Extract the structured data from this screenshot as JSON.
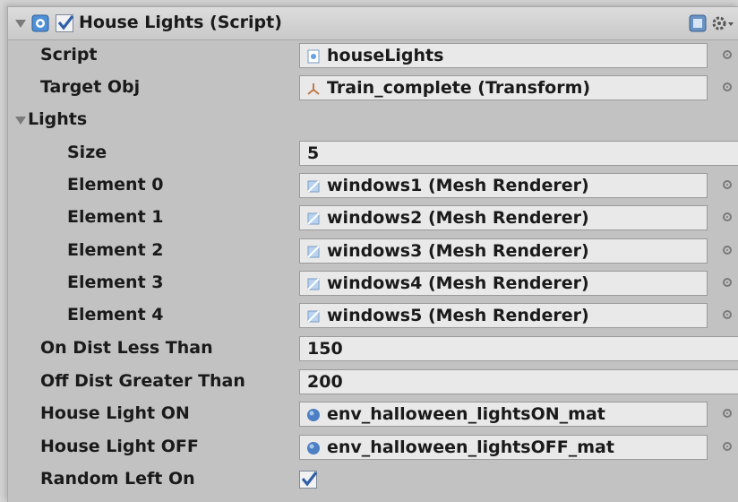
{
  "component": {
    "title": "House Lights (Script)",
    "enabled": true,
    "icons": [
      "script-icon",
      "help-book-icon",
      "gear-menu-icon"
    ]
  },
  "script": {
    "label": "Script",
    "value": "houseLights"
  },
  "target_obj": {
    "label": "Target Obj",
    "value": "Train_complete (Transform)"
  },
  "lights": {
    "label": "Lights",
    "expanded": true,
    "size_label": "Size",
    "size_value": "5",
    "elements": [
      {
        "label": "Element 0",
        "value": "windows1 (Mesh Renderer)"
      },
      {
        "label": "Element 1",
        "value": "windows2 (Mesh Renderer)"
      },
      {
        "label": "Element 2",
        "value": "windows3 (Mesh Renderer)"
      },
      {
        "label": "Element 3",
        "value": "windows4 (Mesh Renderer)"
      },
      {
        "label": "Element 4",
        "value": "windows5 (Mesh Renderer)"
      }
    ]
  },
  "on_dist": {
    "label": "On Dist Less Than",
    "value": "150"
  },
  "off_dist": {
    "label": "Off Dist Greater Than",
    "value": "200"
  },
  "house_light_on": {
    "label": "House Light ON",
    "value": "env_halloween_lightsON_mat"
  },
  "house_light_off": {
    "label": "House Light OFF",
    "value": "env_halloween_lightsOFF_mat"
  },
  "random_left_on": {
    "label": "Random Left On",
    "checked": true
  },
  "colors": {
    "panel_bg": "#c2c2c2",
    "field_bg": "#e9e9e9",
    "check_blue": "#2f5fa8"
  }
}
